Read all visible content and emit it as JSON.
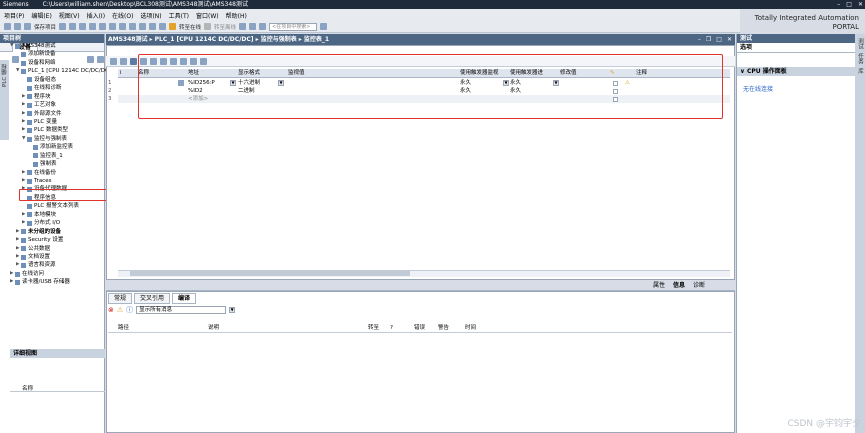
{
  "titlebar": {
    "app": "Siemens",
    "path": "C:\\Users\\william.shen\\Desktop\\BCL308测试\\AMS348测试\\AMS348测试"
  },
  "menu": [
    "项目(P)",
    "编辑(E)",
    "视图(V)",
    "插入(I)",
    "在线(O)",
    "选项(N)",
    "工具(T)",
    "窗口(W)",
    "帮助(H)"
  ],
  "toolbar": {
    "save_label": "保存项目",
    "go_online": "转至在线",
    "go_offline": "转至离线",
    "search_placeholder": "<在项目中搜索>"
  },
  "brand": {
    "line1": "Totally Integrated Automation",
    "line2": "PORTAL"
  },
  "project_tree": {
    "header": "项目树",
    "tab": "设备",
    "side_tab": "PLC 编程",
    "items": [
      {
        "label": "AMS348测试",
        "level": 0,
        "expander": "▼"
      },
      {
        "label": "添加新设备",
        "level": 1,
        "expander": ""
      },
      {
        "label": "设备和网络",
        "level": 1,
        "expander": ""
      },
      {
        "label": "PLC_1 [CPU 1214C DC/DC/DC]",
        "level": 1,
        "expander": "▼"
      },
      {
        "label": "设备组态",
        "level": 2,
        "expander": ""
      },
      {
        "label": "在线和诊断",
        "level": 2,
        "expander": ""
      },
      {
        "label": "程序块",
        "level": 2,
        "expander": "▶"
      },
      {
        "label": "工艺对象",
        "level": 2,
        "expander": "▶"
      },
      {
        "label": "外部源文件",
        "level": 2,
        "expander": "▶"
      },
      {
        "label": "PLC 变量",
        "level": 2,
        "expander": "▶"
      },
      {
        "label": "PLC 数据类型",
        "level": 2,
        "expander": "▶"
      },
      {
        "label": "监控与强制表",
        "level": 2,
        "expander": "▼"
      },
      {
        "label": "添加新监控表",
        "level": 3,
        "expander": ""
      },
      {
        "label": "监控表_1",
        "level": 3,
        "expander": ""
      },
      {
        "label": "强制表",
        "level": 3,
        "expander": ""
      },
      {
        "label": "在线备份",
        "level": 2,
        "expander": "▶"
      },
      {
        "label": "Traces",
        "level": 2,
        "expander": "▶"
      },
      {
        "label": "设备代理数据",
        "level": 2,
        "expander": "▶"
      },
      {
        "label": "程序信息",
        "level": 2,
        "expander": ""
      },
      {
        "label": "PLC 报警文本列表",
        "level": 2,
        "expander": ""
      },
      {
        "label": "本地模块",
        "level": 2,
        "expander": "▶"
      },
      {
        "label": "分布式 I/O",
        "level": 2,
        "expander": "▶"
      },
      {
        "label": "未分组的设备",
        "level": 1,
        "expander": "▶",
        "bold": true
      },
      {
        "label": "Security 设置",
        "level": 1,
        "expander": "▶"
      },
      {
        "label": "公共数据",
        "level": 1,
        "expander": "▶"
      },
      {
        "label": "文档设置",
        "level": 1,
        "expander": "▶"
      },
      {
        "label": "语言和资源",
        "level": 1,
        "expander": "▶"
      },
      {
        "label": "在线访问",
        "level": 0,
        "expander": "▶"
      },
      {
        "label": "读卡器/USB 存储器",
        "level": 0,
        "expander": "▶"
      }
    ],
    "detail_header": "详细视图",
    "detail_name_col": "名称"
  },
  "editor": {
    "breadcrumb": "AMS348测试 ▸ PLC_1 [CPU 1214C DC/DC/DC] ▸ 监控与强制表 ▸ 监控表_1",
    "columns": [
      "i",
      "名称",
      "地址",
      "显示格式",
      "监视值",
      "使用触发器监视",
      "使用触发器进",
      "修改值",
      "",
      "注释"
    ],
    "rows": [
      {
        "num": "1",
        "name": "",
        "address": "%ID256:P",
        "format": "十六进制",
        "monitor": "",
        "trigger_monitor": "永久",
        "trigger_modify": "永久",
        "modify": ""
      },
      {
        "num": "2",
        "name": "",
        "address": "%ID2",
        "format": "二进制",
        "monitor": "",
        "trigger_monitor": "永久",
        "trigger_modify": "永久",
        "modify": ""
      },
      {
        "num": "3",
        "name": "",
        "address": "<添加>",
        "format": "",
        "monitor": "",
        "trigger_monitor": "",
        "trigger_modify": "",
        "modify": ""
      }
    ]
  },
  "inspector": {
    "right_tabs": [
      "属性",
      "信息",
      "诊断"
    ],
    "tabs": [
      "常规",
      "交叉引用",
      "编译"
    ],
    "active_tab": "编译",
    "filter": "显示所有消息",
    "msg_columns": [
      "路径",
      "说明",
      "转至",
      "?",
      "错误",
      "警告",
      "时间"
    ]
  },
  "taskpane": {
    "header": "选项",
    "section": "CPU 操作面板",
    "link": "无在线连接",
    "side_tabs": [
      "测试",
      "任务",
      "库"
    ]
  },
  "watermark": "CSDN @宇钧宇夕",
  "colors": {
    "highlight": "#e0342b",
    "header": "#4c6684"
  }
}
